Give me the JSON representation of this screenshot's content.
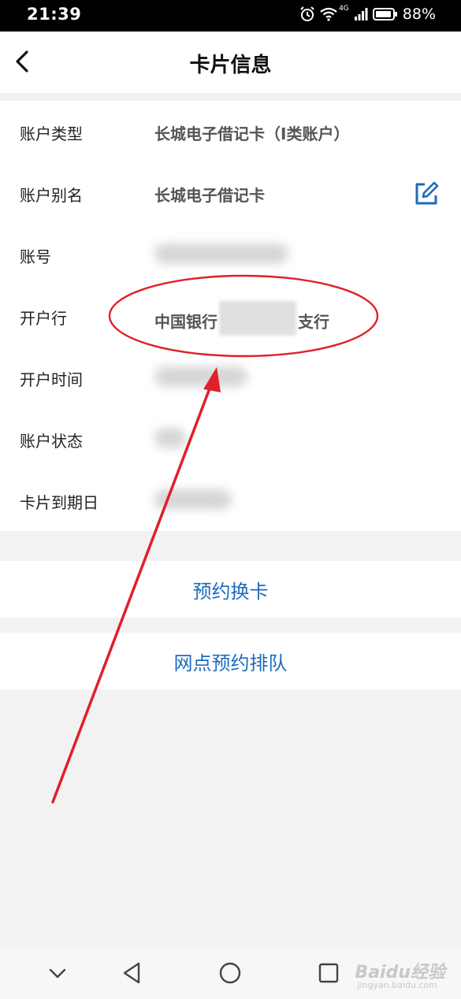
{
  "status": {
    "time": "21:39",
    "network": "4G",
    "battery": "88%"
  },
  "header": {
    "title": "卡片信息"
  },
  "rows": [
    {
      "label": "账户类型",
      "value": "长城电子借记卡（I类账户）"
    },
    {
      "label": "账户别名",
      "value": "长城电子借记卡"
    },
    {
      "label": "账号",
      "value": ""
    },
    {
      "label": "开户行",
      "value_prefix": "中国银行",
      "value_suffix": "支行"
    },
    {
      "label": "开户时间",
      "value": ""
    },
    {
      "label": "账户状态",
      "value": ""
    },
    {
      "label": "卡片到期日",
      "value": ""
    }
  ],
  "actions": {
    "replace_card": "预约换卡",
    "branch_queue": "网点预约排队"
  },
  "watermark": {
    "brand": "Baidu经验",
    "url": "jingyan.baidu.com"
  },
  "colors": {
    "link_blue": "#1c6bbd",
    "annotation_red": "#e0202a"
  }
}
